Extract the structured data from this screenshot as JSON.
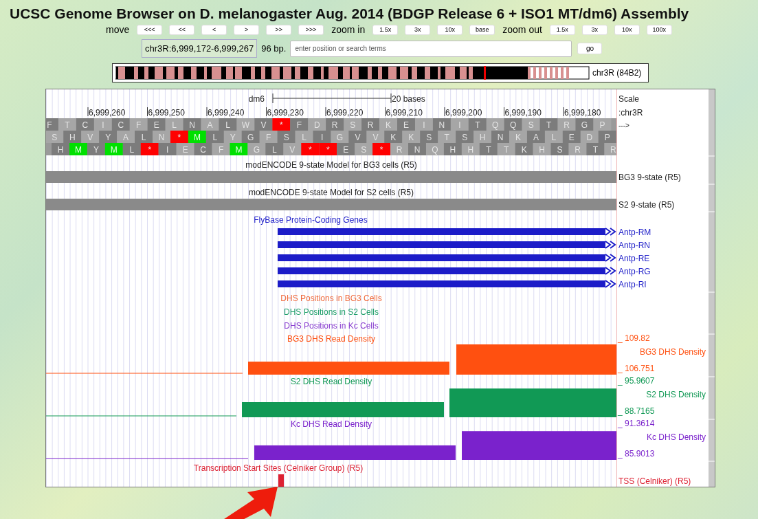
{
  "title": "UCSC Genome Browser on D. melanogaster Aug. 2014 (BDGP Release 6 + ISO1 MT/dm6) Assembly",
  "navigation": {
    "move_label": "move",
    "move_buttons": [
      "<<<",
      "<<",
      "<",
      ">",
      ">>",
      ">>>"
    ],
    "zoom_in_label": "zoom in",
    "zoom_in_buttons": [
      "1.5x",
      "3x",
      "10x",
      "base"
    ],
    "zoom_out_label": "zoom out",
    "zoom_out_buttons": [
      "1.5x",
      "3x",
      "10x",
      "100x"
    ]
  },
  "position": {
    "range": "chr3R:6,999,172-6,999,267",
    "size": "96 bp.",
    "search": {
      "placeholder": "enter position or search terms"
    },
    "go_button": "go"
  },
  "ideogram": {
    "label": "chr3R (84B2)"
  },
  "browser": {
    "ruler": {
      "assembly": "dm6",
      "scale": "20 bases",
      "ticks": [
        "6,999,260",
        "6,999,250",
        "6,999,240",
        "6,999,230",
        "6,999,220",
        "6,999,210",
        "6,999,200",
        "6,999,190",
        "6,999,180"
      ],
      "side_labels": [
        "Scale",
        ":chr3R"
      ]
    },
    "frame_label": "--->",
    "frames": [
      [
        {
          "aa": "F",
          "kind": "plain"
        },
        {
          "aa": "T",
          "kind": "plain"
        },
        {
          "aa": "C",
          "kind": "plain"
        },
        {
          "aa": "I",
          "kind": "plain"
        },
        {
          "aa": "C",
          "kind": "plain"
        },
        {
          "aa": "F",
          "kind": "plain"
        },
        {
          "aa": "E",
          "kind": "plain"
        },
        {
          "aa": "L",
          "kind": "plain"
        },
        {
          "aa": "N",
          "kind": "plain"
        },
        {
          "aa": "A",
          "kind": "plain"
        },
        {
          "aa": "L",
          "kind": "plain"
        },
        {
          "aa": "W",
          "kind": "plain"
        },
        {
          "aa": "V",
          "kind": "plain"
        },
        {
          "aa": "*",
          "kind": "stop"
        },
        {
          "aa": "F",
          "kind": "plain"
        },
        {
          "aa": "D",
          "kind": "plain"
        },
        {
          "aa": "R",
          "kind": "plain"
        },
        {
          "aa": "S",
          "kind": "plain"
        },
        {
          "aa": "R",
          "kind": "plain"
        },
        {
          "aa": "K",
          "kind": "plain"
        },
        {
          "aa": "E",
          "kind": "plain"
        },
        {
          "aa": "I",
          "kind": "plain"
        },
        {
          "aa": "N",
          "kind": "plain"
        },
        {
          "aa": "I",
          "kind": "plain"
        },
        {
          "aa": "T",
          "kind": "plain"
        },
        {
          "aa": "Q",
          "kind": "plain"
        },
        {
          "aa": "Q",
          "kind": "plain"
        },
        {
          "aa": "S",
          "kind": "plain"
        },
        {
          "aa": "T",
          "kind": "plain"
        },
        {
          "aa": "R",
          "kind": "plain"
        },
        {
          "aa": "G",
          "kind": "plain"
        },
        {
          "aa": "P",
          "kind": "plain"
        }
      ],
      [
        {
          "aa": "S",
          "kind": "plain"
        },
        {
          "aa": "H",
          "kind": "plain"
        },
        {
          "aa": "V",
          "kind": "plain"
        },
        {
          "aa": "Y",
          "kind": "plain"
        },
        {
          "aa": "A",
          "kind": "plain"
        },
        {
          "aa": "L",
          "kind": "plain"
        },
        {
          "aa": "N",
          "kind": "plain"
        },
        {
          "aa": "*",
          "kind": "stop"
        },
        {
          "aa": "M",
          "kind": "start"
        },
        {
          "aa": "L",
          "kind": "plain"
        },
        {
          "aa": "Y",
          "kind": "plain"
        },
        {
          "aa": "G",
          "kind": "plain"
        },
        {
          "aa": "F",
          "kind": "plain"
        },
        {
          "aa": "S",
          "kind": "plain"
        },
        {
          "aa": "L",
          "kind": "plain"
        },
        {
          "aa": "I",
          "kind": "plain"
        },
        {
          "aa": "G",
          "kind": "plain"
        },
        {
          "aa": "V",
          "kind": "plain"
        },
        {
          "aa": "V",
          "kind": "plain"
        },
        {
          "aa": "K",
          "kind": "plain"
        },
        {
          "aa": "K",
          "kind": "plain"
        },
        {
          "aa": "S",
          "kind": "plain"
        },
        {
          "aa": "T",
          "kind": "plain"
        },
        {
          "aa": "S",
          "kind": "plain"
        },
        {
          "aa": "H",
          "kind": "plain"
        },
        {
          "aa": "N",
          "kind": "plain"
        },
        {
          "aa": "K",
          "kind": "plain"
        },
        {
          "aa": "A",
          "kind": "plain"
        },
        {
          "aa": "L",
          "kind": "plain"
        },
        {
          "aa": "E",
          "kind": "plain"
        },
        {
          "aa": "D",
          "kind": "plain"
        },
        {
          "aa": "P",
          "kind": "plain"
        }
      ],
      [
        {
          "aa": "H",
          "kind": "plain"
        },
        {
          "aa": "M",
          "kind": "start"
        },
        {
          "aa": "Y",
          "kind": "plain"
        },
        {
          "aa": "M",
          "kind": "start"
        },
        {
          "aa": "L",
          "kind": "plain"
        },
        {
          "aa": "*",
          "kind": "stop"
        },
        {
          "aa": "I",
          "kind": "plain"
        },
        {
          "aa": "E",
          "kind": "plain"
        },
        {
          "aa": "C",
          "kind": "plain"
        },
        {
          "aa": "F",
          "kind": "plain"
        },
        {
          "aa": "M",
          "kind": "start"
        },
        {
          "aa": "G",
          "kind": "plain"
        },
        {
          "aa": "L",
          "kind": "plain"
        },
        {
          "aa": "V",
          "kind": "plain"
        },
        {
          "aa": "*",
          "kind": "stop"
        },
        {
          "aa": "*",
          "kind": "stop"
        },
        {
          "aa": "E",
          "kind": "plain"
        },
        {
          "aa": "S",
          "kind": "plain"
        },
        {
          "aa": "*",
          "kind": "stop"
        },
        {
          "aa": "R",
          "kind": "plain"
        },
        {
          "aa": "N",
          "kind": "plain"
        },
        {
          "aa": "Q",
          "kind": "plain"
        },
        {
          "aa": "H",
          "kind": "plain"
        },
        {
          "aa": "H",
          "kind": "plain"
        },
        {
          "aa": "T",
          "kind": "plain"
        },
        {
          "aa": "T",
          "kind": "plain"
        },
        {
          "aa": "K",
          "kind": "plain"
        },
        {
          "aa": "H",
          "kind": "plain"
        },
        {
          "aa": "S",
          "kind": "plain"
        },
        {
          "aa": "R",
          "kind": "plain"
        },
        {
          "aa": "T",
          "kind": "plain"
        },
        {
          "aa": "R",
          "kind": "plain"
        }
      ]
    ],
    "tracks": [
      {
        "kind": "state",
        "title": "modENCODE 9-state Model for BG3 cells (R5)",
        "label": "BG3 9-state (R5)"
      },
      {
        "kind": "state",
        "title": "modENCODE 9-state Model for S2 cells (R5)",
        "label": "S2 9-state (R5)"
      },
      {
        "kind": "genes",
        "title": "FlyBase Protein-Coding Genes",
        "color": "#1c1cc8",
        "genes": [
          "Antp-RM",
          "Antp-RN",
          "Antp-RE",
          "Antp-RG",
          "Antp-RI"
        ]
      },
      {
        "kind": "positions",
        "title": "DHS Positions in BG3 Cells",
        "color": "#f06a3c"
      },
      {
        "kind": "positions",
        "title": "DHS Positions in S2 Cells",
        "color": "#1f9f6a"
      },
      {
        "kind": "positions",
        "title": "DHS Positions in Kc Cells",
        "color": "#8a3fd0"
      },
      {
        "kind": "density",
        "title": "BG3 DHS Read Density",
        "color": "#ff5010",
        "label": "BG3 DHS Density",
        "max": "_ 109.82",
        "min": "_ 106.751"
      },
      {
        "kind": "density",
        "title": "S2 DHS Read Density",
        "color": "#119955",
        "label": "S2 DHS Density",
        "max": "_ 95.9607",
        "min": "_ 88.7165"
      },
      {
        "kind": "density",
        "title": "Kc DHS Read Density",
        "color": "#7a22cc",
        "label": "Kc DHS Density",
        "max": "_ 91.3614",
        "min": "_ 85.9013"
      },
      {
        "kind": "tss",
        "title": "Transcription Start Sites (Celniker Group) (R5)",
        "color": "#dd2233",
        "label": "TSS (Celniker) (R5)"
      }
    ]
  }
}
